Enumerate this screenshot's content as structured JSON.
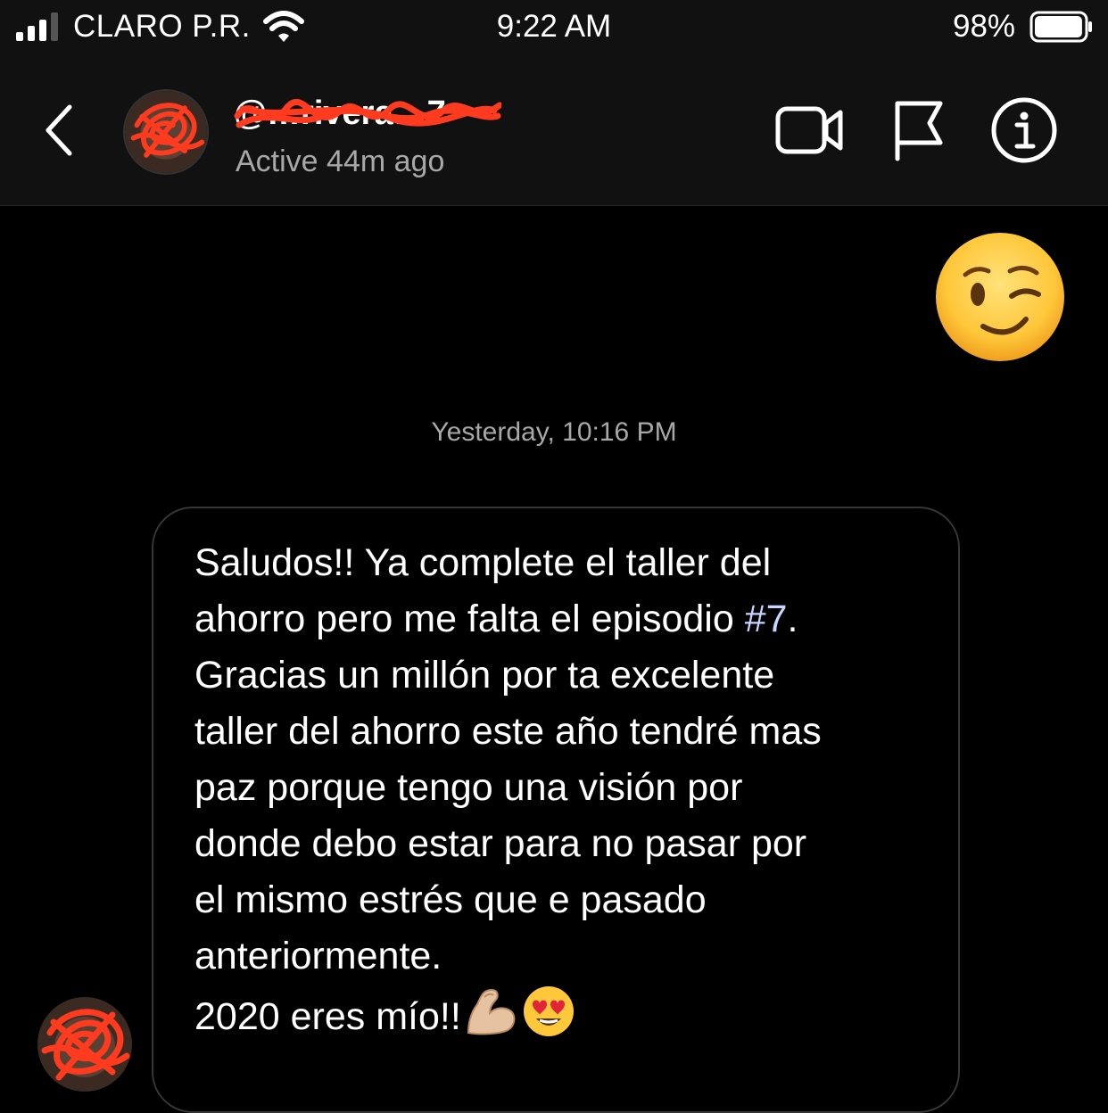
{
  "status_bar": {
    "carrier": "CLARO P.R.",
    "time": "9:22 AM",
    "battery_percent": "98%",
    "battery_level": 0.98
  },
  "header": {
    "username": "@…rivera…7",
    "active_status": "Active 44m ago",
    "icons": [
      "back-chevron-icon",
      "video-camera-icon",
      "flag-icon",
      "info-icon"
    ]
  },
  "messages": {
    "sent_emoji": "winking-face-emoji",
    "timestamp": "Yesterday, 10:16 PM",
    "received": {
      "lines": [
        "Saludos!! Ya complete el taller del",
        "ahorro pero me falta el episodio ",
        "Gracias un millón por ta excelente",
        "taller del ahorro este año tendré mas",
        "paz porque tengo una visión por",
        "donde debo estar para no pasar por",
        "el mismo estrés que e pasado",
        "anteriormente.",
        "2020 eres mío!!"
      ],
      "hashtag": "#7",
      "hashtag_suffix": ".",
      "emojis": [
        "flexed-biceps-emoji",
        "heart-eyes-emoji"
      ]
    }
  },
  "colors": {
    "background": "#000000",
    "header_bg": "#111111",
    "secondary_text": "#a8a8a8",
    "bubble_border": "#363636",
    "hashtag": "#c7d4ff",
    "redaction": "#ff3b1f"
  }
}
